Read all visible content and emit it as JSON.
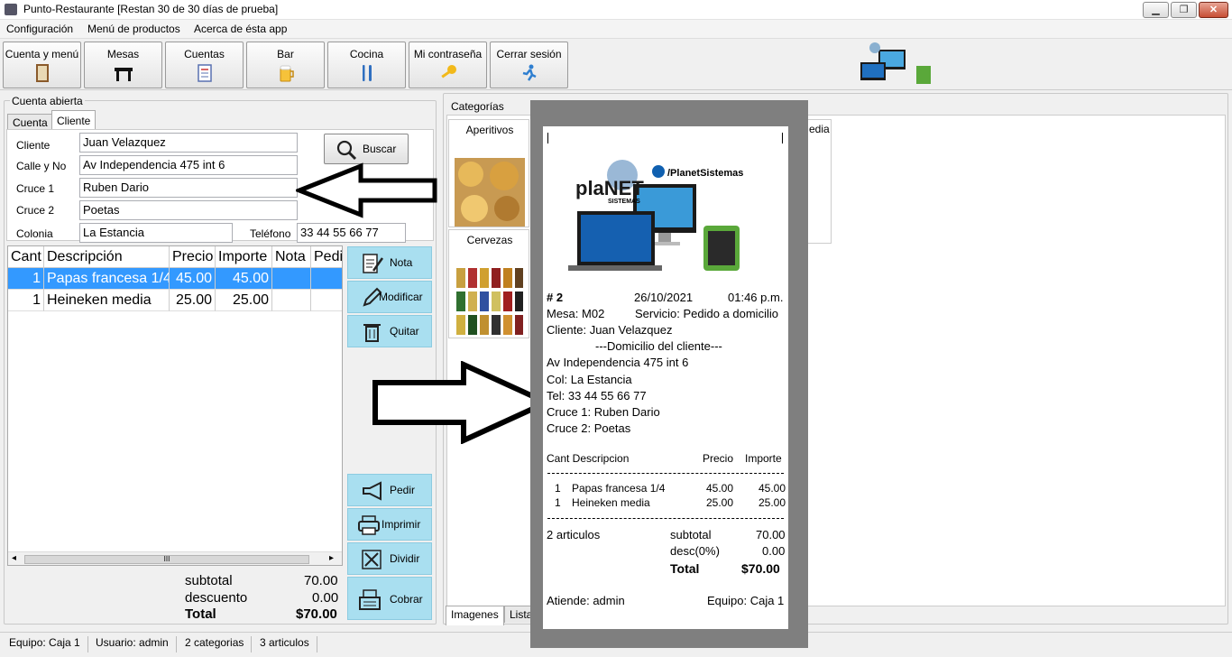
{
  "window": {
    "title": "Punto-Restaurante [Restan 30 de 30 días de prueba]",
    "min": "▁",
    "max": "❐",
    "close": "✕"
  },
  "menu": [
    "Configuración",
    "Menú de productos",
    "Acerca de ésta app"
  ],
  "toolbar": [
    "Cuenta y menú",
    "Mesas",
    "Cuentas",
    "Bar",
    "Cocina",
    "Mi contraseña",
    "Cerrar sesión"
  ],
  "account": {
    "group_label": "Cuenta abierta",
    "tabs": [
      "Cuenta",
      "Cliente"
    ],
    "labels": {
      "cliente": "Cliente",
      "calle": "Calle y No",
      "cruce1": "Cruce 1",
      "cruce2": "Cruce 2",
      "colonia": "Colonia",
      "telefono": "Teléfono"
    },
    "values": {
      "cliente": "Juan Velazquez",
      "calle": "Av Independencia 475 int 6",
      "cruce1": "Ruben Dario",
      "cruce2": "Poetas",
      "colonia": "La Estancia",
      "telefono": "33 44 55 66 77"
    },
    "search_label": "Buscar"
  },
  "grid": {
    "headers": [
      "Cant",
      "Descripción",
      "Precio",
      "Importe",
      "Nota",
      "Pedi"
    ],
    "rows": [
      {
        "cant": "1",
        "desc": "Papas francesa 1/4",
        "precio": "45.00",
        "importe": "45.00"
      },
      {
        "cant": "1",
        "desc": "Heineken media",
        "precio": "25.00",
        "importe": "25.00"
      }
    ],
    "scroll_mark": "III"
  },
  "side_buttons": {
    "nota": "Nota",
    "modificar": "Modificar",
    "quitar": "Quitar",
    "pedir": "Pedir",
    "imprimir": "Imprimir",
    "dividir": "Dividir",
    "cobrar": "Cobrar"
  },
  "totals": {
    "subtotal_label": "subtotal",
    "subtotal": "70.00",
    "descuento_label": "descuento",
    "descuento": "0.00",
    "total_label": "Total",
    "total": "$70.00"
  },
  "categories": {
    "label": "Categorías",
    "items": [
      "Aperitivos",
      "Cervezas"
    ],
    "partial_item": "edia",
    "bottom_tabs": [
      "Imagenes",
      "Lista"
    ]
  },
  "receipt": {
    "fb_handle": "/PlanetSistemas",
    "brand": "plaNET",
    "brand_sub": "SISTEMAS",
    "number": "# 2",
    "date": "26/10/2021",
    "time": "01:46 p.m.",
    "mesa": "Mesa: M02",
    "servicio": "Servicio: Pedido a domicilio",
    "cliente": "Cliente: Juan Velazquez",
    "domicilio_header": "---Domicilio del cliente---",
    "direccion": "Av Independencia 475 int 6",
    "col": "Col: La Estancia",
    "tel": "Tel: 33 44 55 66 77",
    "cruce1": "Cruce 1: Ruben Dario",
    "cruce2": "Cruce 2: Poetas",
    "headers": {
      "cant_desc": "Cant Descripcion",
      "precio": "Precio",
      "importe": "Importe"
    },
    "items": [
      {
        "cant": "1",
        "desc": "Papas francesa 1/4",
        "precio": "45.00",
        "importe": "45.00"
      },
      {
        "cant": "1",
        "desc": "Heineken media",
        "precio": "25.00",
        "importe": "25.00"
      }
    ],
    "articulos": "2 articulos",
    "subtotal_label": "subtotal",
    "subtotal": "70.00",
    "desc_label": "desc(0%)",
    "desc": "0.00",
    "total_label": "Total",
    "total": "$70.00",
    "atiende": "Atiende: admin",
    "equipo": "Equipo: Caja 1"
  },
  "status": [
    "Equipo: Caja 1",
    "Usuario: admin",
    "2 categorias",
    "3 articulos"
  ]
}
